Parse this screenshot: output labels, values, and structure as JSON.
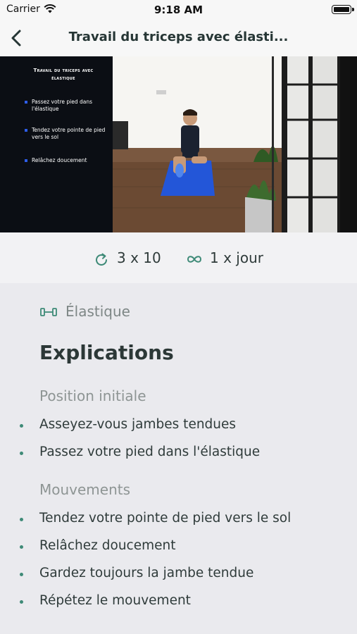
{
  "status_bar": {
    "carrier": "Carrier",
    "time": "9:18 AM"
  },
  "nav": {
    "title": "Travail du triceps avec élasti..."
  },
  "video": {
    "panel_title": "Travail du triceps avec élastique",
    "steps": [
      "Passez votre pied dans l'élastique",
      "Tendez votre pointe de pied vers le sol",
      "Relâchez doucement"
    ]
  },
  "meta": {
    "sets": "3 x 10",
    "frequency": "1 x jour"
  },
  "equipment": {
    "label": "Élastique",
    "icon": "dumbbell-icon"
  },
  "explanations": {
    "heading": "Explications",
    "sections": [
      {
        "title": "Position initiale",
        "items": [
          "Asseyez-vous jambes tendues",
          "Passez votre pied dans l'élastique"
        ]
      },
      {
        "title": "Mouvements",
        "items": [
          "Tendez votre pointe de pied vers le sol",
          "Relâchez doucement",
          "Gardez toujours la jambe tendue",
          "Répétez le mouvement"
        ]
      }
    ]
  },
  "colors": {
    "accent": "#3e8a77",
    "mat": "#2356d8"
  }
}
